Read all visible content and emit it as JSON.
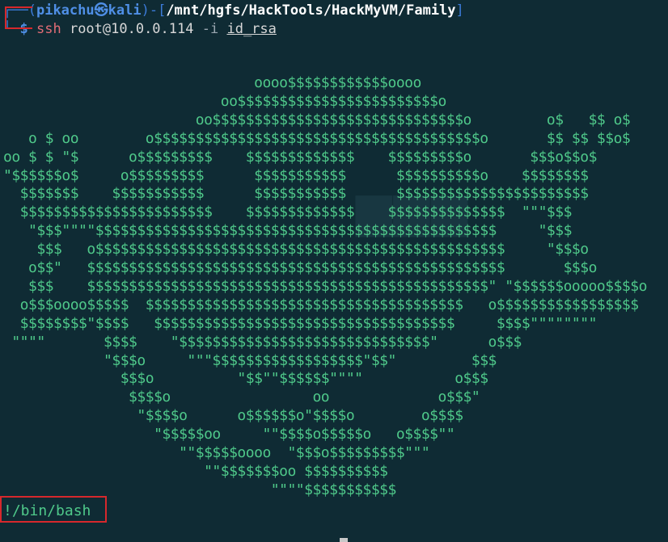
{
  "window": {
    "background": "#0f2b34"
  },
  "prompt": {
    "open_paren": "(",
    "user": "pikachu",
    "host_symbol": "㉿",
    "host": "kali",
    "close_paren": ")",
    "sep": "-[",
    "path": "/mnt/hgfs/HackTools/HackMyVM/Family",
    "close_bracket": "]",
    "dollar": "$",
    "command": "ssh",
    "target": "root@10.0.0.114",
    "flag": "-i",
    "keyfile": "id_rsa"
  },
  "banner_lines": [
    "                              oooo$$$$$$$$$$$$oooo",
    "                          oo$$$$$$$$$$$$$$$$$$$$$$$$o",
    "                       oo$$$$$$$$$$$$$$$$$$$$$$$$$$$$$$o         o$   $$ o$",
    "   o $ oo        o$$$$$$$$$$$$$$$$$$$$$$$$$$$$$$$$$$$$$$$o       $$ $$ $$o$",
    "oo $ $ \"$      o$$$$$$$$$    $$$$$$$$$$$$$    $$$$$$$$$o       $$$o$$o$",
    "\"$$$$$$o$     o$$$$$$$$$      $$$$$$$$$$$      $$$$$$$$$$o    $$$$$$$$",
    "  $$$$$$$    $$$$$$$$$$$      $$$$$$$$$$$      $$$$$$$$$$$$$$$$$$$$$$$",
    "  $$$$$$$$$$$$$$$$$$$$$$$    $$$$$$$$$$$$$    $$$$$$$$$$$$$$  \"\"\"$$$",
    "   \"$$$\"\"\"\"$$$$$$$$$$$$$$$$$$$$$$$$$$$$$$$$$$$$$$$$$$$$$$$$     \"$$$",
    "    $$$   o$$$$$$$$$$$$$$$$$$$$$$$$$$$$$$$$$$$$$$$$$$$$$$$$$     \"$$$o",
    "   o$$\"   $$$$$$$$$$$$$$$$$$$$$$$$$$$$$$$$$$$$$$$$$$$$$$$$$$       $$$o",
    "   $$$    $$$$$$$$$$$$$$$$$$$$$$$$$$$$$$$$$$$$$$$$$$$$$$$$\" \"$$$$$$ooooo$$$$o",
    "  o$$$oooo$$$$$  $$$$$$$$$$$$$$$$$$$$$$$$$$$$$$$$$$$$$$   o$$$$$$$$$$$$$$$$$",
    "  $$$$$$$$\"$$$$   $$$$$$$$$$$$$$$$$$$$$$$$$$$$$$$$$$$$     $$$$\"\"\"\"\"\"\"\"",
    " \"\"\"\"       $$$$    \"$$$$$$$$$$$$$$$$$$$$$$$$$$$$$$\"      o$$$",
    "            \"$$$o     \"\"\"$$$$$$$$$$$$$$$$$$\"$$\"         $$$",
    "              $$$o          \"$$\"\"$$$$$$\"\"\"\"           o$$$",
    "               $$$$o                 oo             o$$$\"",
    "                \"$$$$o      o$$$$$$o\"$$$$o        o$$$$",
    "                  \"$$$$$oo     \"\"$$$$o$$$$$o   o$$$$\"\"",
    "                     \"\"$$$$$oooo  \"$$$o$$$$$$$$$\"\"\"",
    "                        \"\"$$$$$$$oo $$$$$$$$$$",
    "                                \"\"\"\"$$$$$$$$$$$"
  ],
  "shell_output": "!/bin/bash",
  "colors": {
    "ascii": "#4fc98a",
    "prompt_blue": "#4f8fe6",
    "command_red": "#e06c75",
    "highlight_box": "#d6282c"
  }
}
